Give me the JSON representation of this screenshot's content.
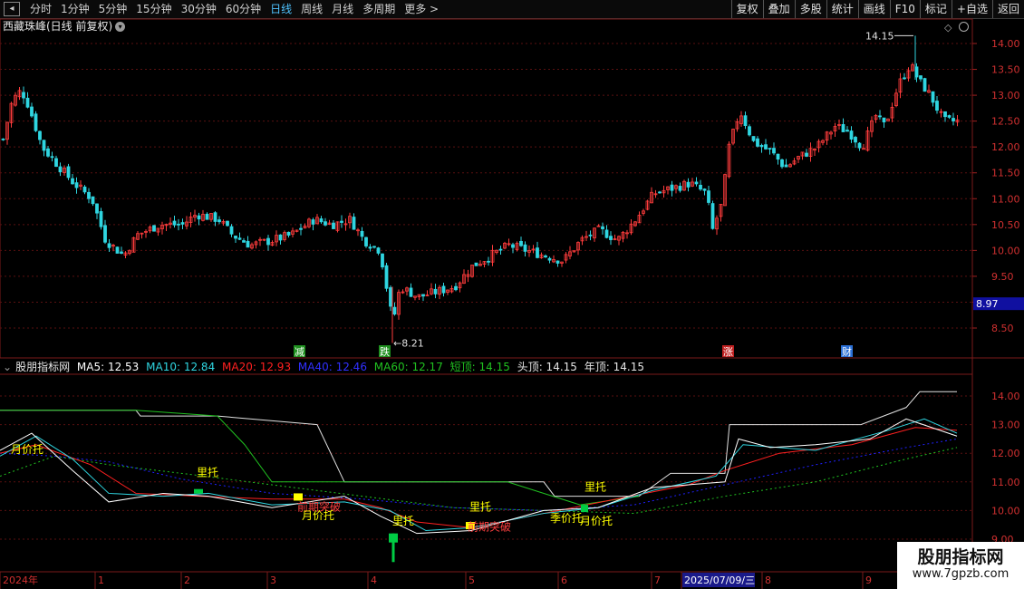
{
  "toolbar": {
    "items": [
      "分时",
      "1分钟",
      "5分钟",
      "15分钟",
      "30分钟",
      "60分钟",
      "日线",
      "周线",
      "月线",
      "多周期",
      "更多 >"
    ],
    "active": "日线",
    "right_buttons": [
      "复权",
      "叠加",
      "多股",
      "统计",
      "画线",
      "F10",
      "标记",
      "+自选",
      "返回"
    ]
  },
  "chart_title": "西藏珠峰(日线 前复权)",
  "price_axis": {
    "ticks": [
      "14.00",
      "13.50",
      "13.00",
      "12.50",
      "12.00",
      "11.50",
      "11.00",
      "10.50",
      "10.00",
      "9.50",
      "9.00",
      "8.50"
    ],
    "current_price": "8.97"
  },
  "price_annotations": {
    "high": "14.15",
    "low": "8.21"
  },
  "event_tags": [
    {
      "text": "减",
      "color": "#1e8f1e"
    },
    {
      "text": "跌",
      "color": "#1e8f1e"
    },
    {
      "text": "涨",
      "color": "#c02020"
    },
    {
      "text": "财",
      "color": "#2a6fd6"
    }
  ],
  "indicator": {
    "name": "股朋指标网",
    "ma5": "MA5: 12.53",
    "ma10": "MA10: 12.84",
    "ma20": "MA20: 12.93",
    "ma40": "MA40: 12.46",
    "ma60": "MA60: 12.17",
    "short_top": "短顶: 14.15",
    "head_top": "头顶: 14.15",
    "year_top": "年顶: 14.15",
    "axis_ticks": [
      "14.00",
      "13.00",
      "12.00",
      "11.00",
      "10.00",
      "9.00"
    ]
  },
  "signals": [
    "月价托",
    "里托",
    "前期突破",
    "月价托",
    "里托",
    "里托",
    "前期突破",
    "季价托",
    "里托",
    "月价托"
  ],
  "x_axis": {
    "labels": [
      "2024年",
      "1",
      "2",
      "3",
      "4",
      "5",
      "6",
      "7",
      "2025/07/09/三",
      "8",
      "9"
    ]
  },
  "watermark": {
    "title": "股朋指标网",
    "url": "www.7gpzb.com"
  },
  "colors": {
    "up": "#ff3c3c",
    "down": "#2fd5e0",
    "ma5": "#ffffff",
    "ma10": "#2fd5e0",
    "ma20": "#ff2020",
    "ma40": "#2020ff",
    "ma60": "#20c020",
    "signal": "#ffff00"
  }
}
